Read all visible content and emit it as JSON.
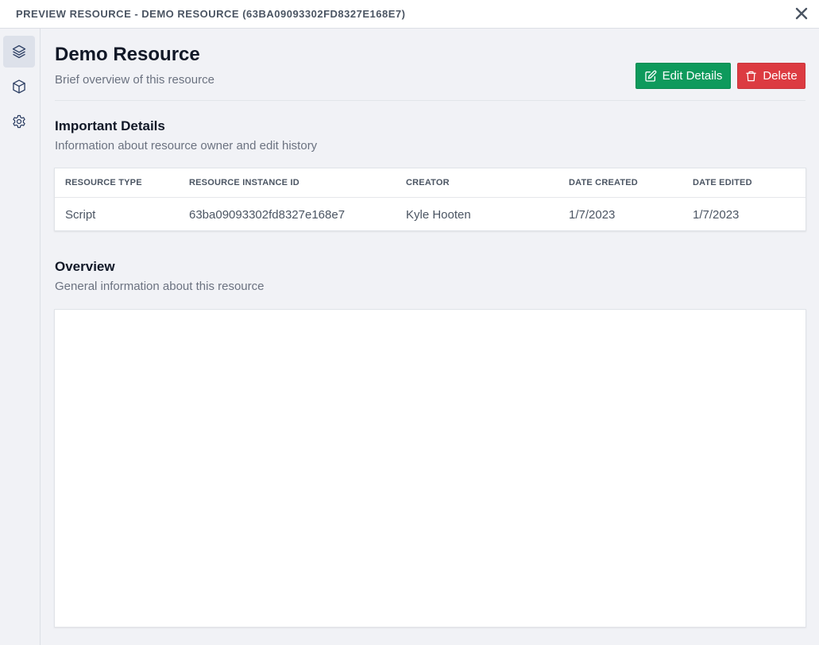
{
  "window": {
    "title": "PREVIEW RESOURCE - DEMO RESOURCE (63BA09093302FD8327E168E7)"
  },
  "sidebar": {
    "items": [
      {
        "icon": "layers-icon",
        "active": true
      },
      {
        "icon": "cube-icon",
        "active": false
      },
      {
        "icon": "gear-icon",
        "active": false
      }
    ]
  },
  "header": {
    "title": "Demo Resource",
    "subtitle": "Brief overview of this resource",
    "edit_label": "Edit Details",
    "delete_label": "Delete"
  },
  "details": {
    "title": "Important Details",
    "subtitle": "Information about resource owner and edit history",
    "columns": [
      "RESOURCE TYPE",
      "RESOURCE INSTANCE ID",
      "CREATOR",
      "DATE CREATED",
      "DATE EDITED"
    ],
    "row": [
      "Script",
      "63ba09093302fd8327e168e7",
      "Kyle Hooten",
      "1/7/2023",
      "1/7/2023"
    ]
  },
  "overview": {
    "title": "Overview",
    "subtitle": "General information about this resource"
  },
  "colors": {
    "edit_button": "#0e9a5c",
    "delete_button": "#dc3b41",
    "background": "#f1f2f6"
  }
}
